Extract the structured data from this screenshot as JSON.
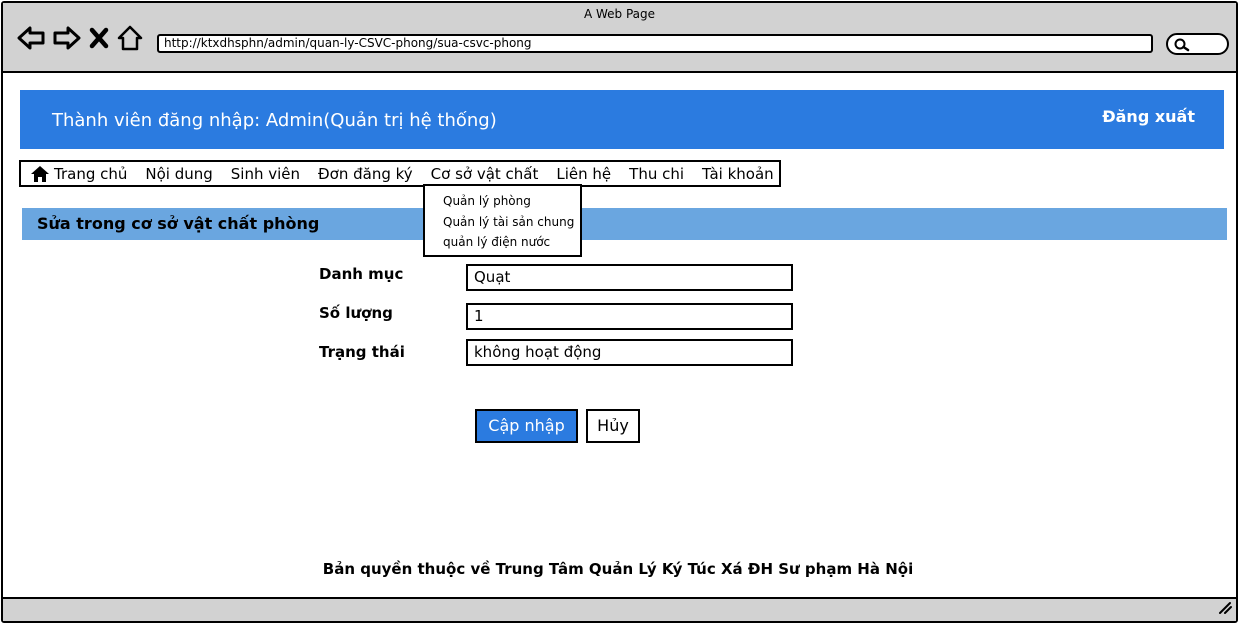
{
  "browser": {
    "window_title": "A Web Page",
    "url": "http://ktxdhsphn/admin/quan-ly-CSVC-phong/sua-csvc-phong",
    "icons": [
      "back-arrow-icon",
      "forward-arrow-icon",
      "close-icon",
      "home-icon",
      "search-icon",
      "resize-grip-icon"
    ]
  },
  "header": {
    "welcome": "Thành viên đăng nhập: Admin(Quản trị hệ thống)",
    "logout": "Đăng xuất",
    "bg_color": "#2b7be0"
  },
  "menu": {
    "items": [
      {
        "label": "Trang chủ",
        "icon": "home-icon"
      },
      {
        "label": "Nội dung"
      },
      {
        "label": "Sinh viên"
      },
      {
        "label": "Đơn đăng ký"
      },
      {
        "label": "Cơ sở vật chất"
      },
      {
        "label": "Liên hệ"
      },
      {
        "label": "Thu chi"
      },
      {
        "label": "Tài khoản"
      }
    ],
    "dropdown": [
      "Quản lý phòng",
      "Quản lý tài sản chung",
      "quản lý điện nước"
    ]
  },
  "section": {
    "title": "Sửa trong cơ sở vật chất phòng",
    "bg_color": "#6aa6e0"
  },
  "form": {
    "fields": [
      {
        "label": "Danh mục",
        "value": "Quạt"
      },
      {
        "label": "Số lượng",
        "value": "1"
      },
      {
        "label": "Trạng thái",
        "value": "không hoạt động"
      }
    ],
    "submit_label": "Cập nhập",
    "cancel_label": "Hủy"
  },
  "footer": {
    "text": "Bản quyền thuộc về Trung Tâm Quản Lý Ký Túc Xá ĐH Sư phạm Hà Nội"
  }
}
